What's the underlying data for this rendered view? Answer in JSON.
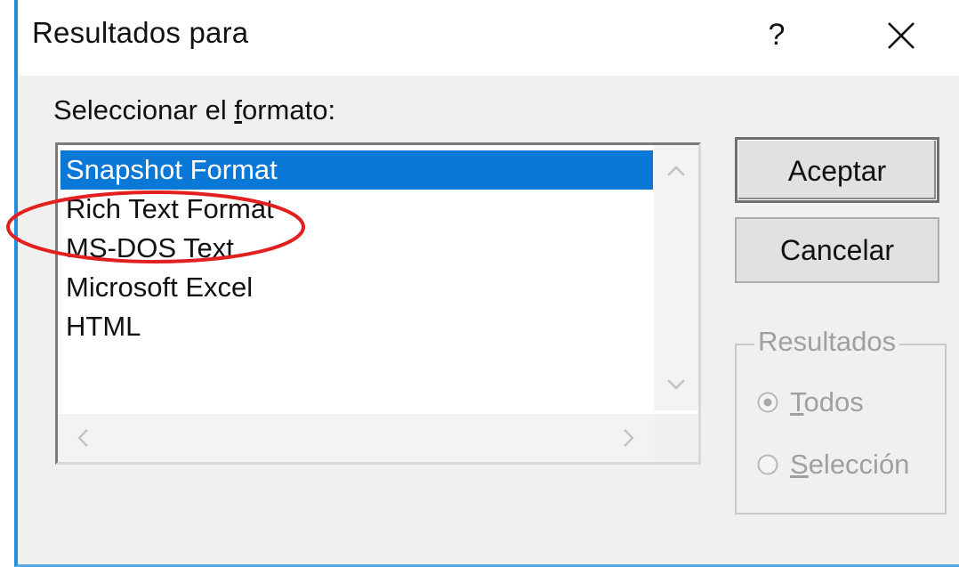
{
  "window": {
    "title": "Resultados para",
    "help_glyph": "?",
    "close_icon": "close-icon"
  },
  "format": {
    "label_prefix": "Seleccionar el ",
    "label_accel": "f",
    "label_suffix": "ormato:",
    "items": [
      {
        "label": "Snapshot Format",
        "selected": true
      },
      {
        "label": "Rich Text Format",
        "selected": false
      },
      {
        "label": "MS-DOS Text",
        "selected": false
      },
      {
        "label": "Microsoft Excel",
        "selected": false
      },
      {
        "label": "HTML",
        "selected": false
      }
    ]
  },
  "buttons": {
    "ok": "Aceptar",
    "cancel": "Cancelar"
  },
  "results_group": {
    "legend": "Resultados",
    "options": [
      {
        "accel": "T",
        "rest": "odos",
        "checked": true,
        "enabled": false
      },
      {
        "accel": "S",
        "rest": "elección",
        "checked": false,
        "enabled": false
      }
    ]
  },
  "colors": {
    "selection": "#0a78d7",
    "annotation": "#e32020",
    "window_accent": "#1e8fd8"
  }
}
